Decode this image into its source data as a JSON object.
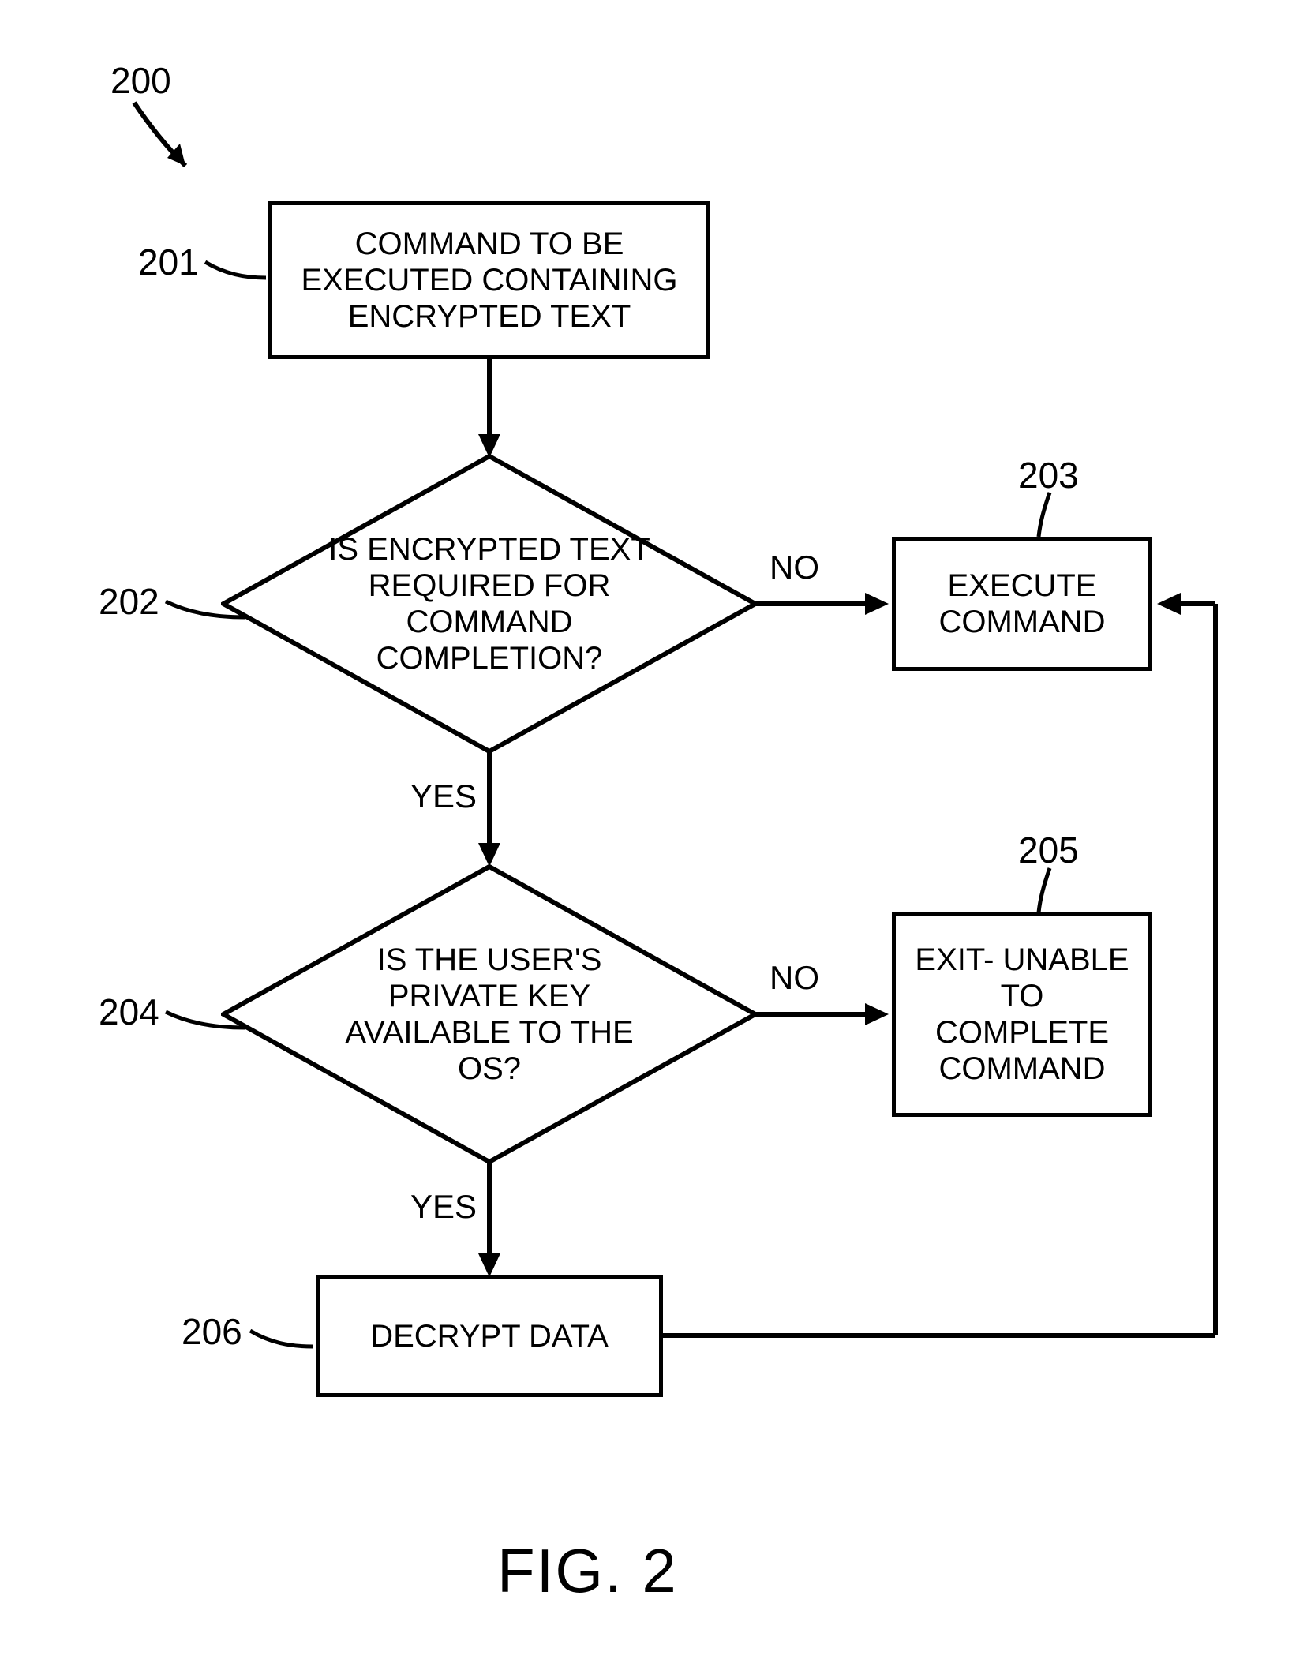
{
  "chart_data": {
    "type": "flowchart",
    "title_ref": "200",
    "figure_label": "FIG. 2",
    "nodes": [
      {
        "id": "201",
        "ref": "201",
        "shape": "process",
        "text": "COMMAND TO BE EXECUTED CONTAINING ENCRYPTED TEXT"
      },
      {
        "id": "202",
        "ref": "202",
        "shape": "decision",
        "text": "IS ENCRYPTED TEXT REQUIRED FOR COMMAND COMPLETION?"
      },
      {
        "id": "203",
        "ref": "203",
        "shape": "process",
        "text": "EXECUTE COMMAND"
      },
      {
        "id": "204",
        "ref": "204",
        "shape": "decision",
        "text": "IS THE USER'S PRIVATE KEY AVAILABLE TO THE OS?"
      },
      {
        "id": "205",
        "ref": "205",
        "shape": "process",
        "text": "EXIT- UNABLE TO COMPLETE COMMAND"
      },
      {
        "id": "206",
        "ref": "206",
        "shape": "process",
        "text": "DECRYPT DATA"
      }
    ],
    "edges": [
      {
        "from": "201",
        "to": "202",
        "label": ""
      },
      {
        "from": "202",
        "to": "203",
        "label": "NO"
      },
      {
        "from": "202",
        "to": "204",
        "label": "YES"
      },
      {
        "from": "204",
        "to": "205",
        "label": "NO"
      },
      {
        "from": "204",
        "to": "206",
        "label": "YES"
      },
      {
        "from": "206",
        "to": "203",
        "label": ""
      }
    ],
    "edge_labels": {
      "yes": "YES",
      "no": "NO"
    }
  }
}
